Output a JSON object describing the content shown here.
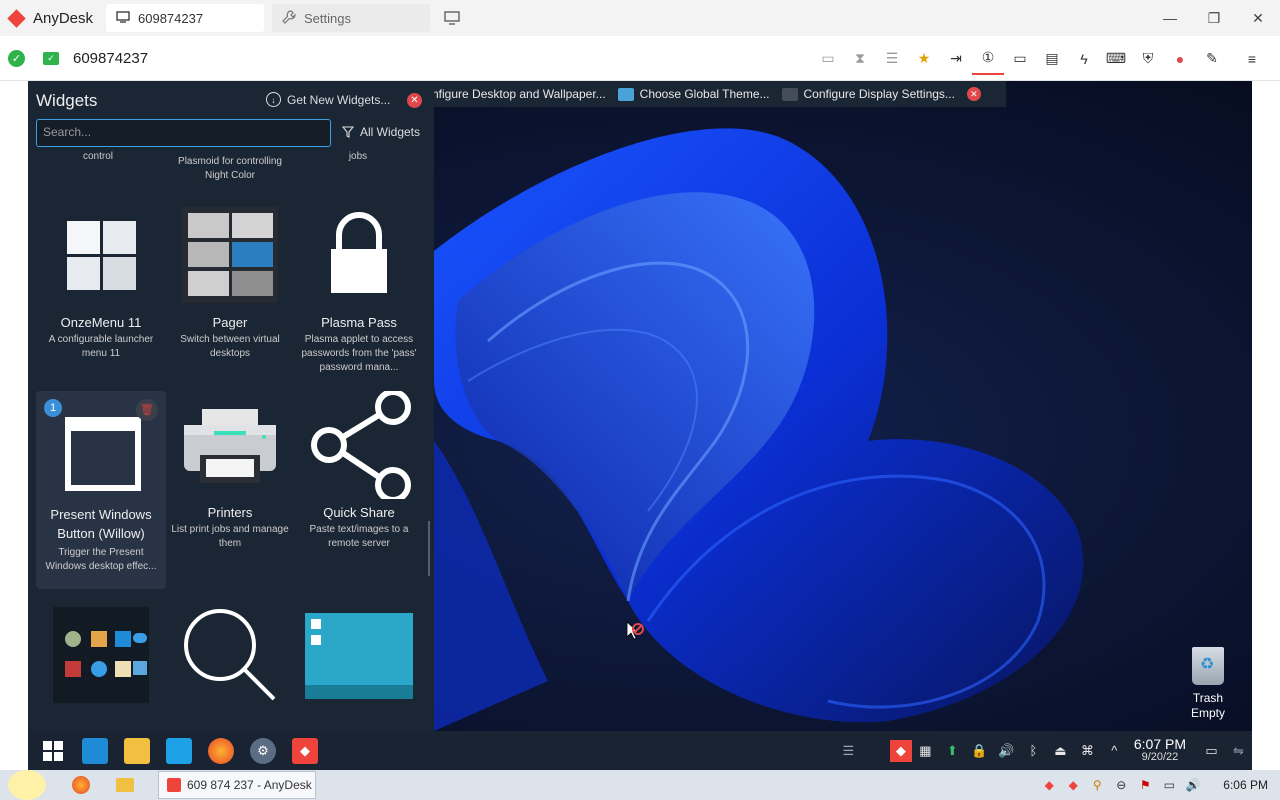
{
  "app": {
    "name": "AnyDesk",
    "brand_color": "#ef443b"
  },
  "tabs": [
    {
      "label": "609874237",
      "icon": "monitor-icon"
    },
    {
      "label": "Settings",
      "icon": "wrench-icon"
    }
  ],
  "window_controls": {
    "minimize": "—",
    "maximize": "❐",
    "close": "✕"
  },
  "toolbar": {
    "address": "609874237",
    "tools": [
      "screen-off-icon",
      "hourglass-icon",
      "database-icon",
      "star-icon",
      "file-transfer-icon",
      "display-1-icon",
      "display-icon",
      "chat-icon",
      "action-icon",
      "keyboard-icon",
      "privacy-icon",
      "record-icon",
      "whiteboard-icon",
      "menu-icon"
    ]
  },
  "widgets": {
    "title": "Widgets",
    "get_new": "Get New Widgets...",
    "search_placeholder": "Search...",
    "filter": "All Widgets",
    "partial_row": [
      "control",
      "Plasmoid for controlling Night Color",
      "jobs"
    ],
    "items": [
      {
        "name": "OnzeMenu 11",
        "desc": "A configurable launcher menu 11"
      },
      {
        "name": "Pager",
        "desc": "Switch between virtual desktops"
      },
      {
        "name": "Plasma Pass",
        "desc": "Plasma applet to access passwords from the 'pass' password mana..."
      },
      {
        "name": "Present Windows Button (Willow)",
        "desc": "Trigger the Present Windows desktop effec...",
        "count": "1"
      },
      {
        "name": "Printers",
        "desc": "List print jobs and manage them"
      },
      {
        "name": "Quick Share",
        "desc": "Paste text/images to a remote server"
      }
    ]
  },
  "plasma_bar": [
    "nfigure Desktop and Wallpaper...",
    "Choose Global Theme...",
    "Configure Display Settings..."
  ],
  "desktop": {
    "trash_label": "Trash",
    "trash_status": "Empty"
  },
  "remote_clock": {
    "time": "6:07 PM",
    "date": "9/20/22"
  },
  "win_taskbar": {
    "active_window": "609 874 237 - AnyDesk",
    "time": "6:06 PM"
  }
}
